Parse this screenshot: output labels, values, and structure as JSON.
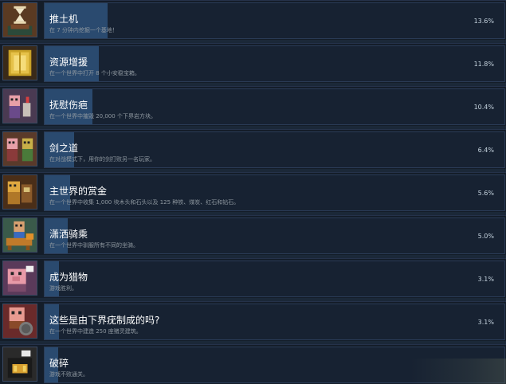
{
  "achievements": [
    {
      "title": "推土机",
      "desc": "在 7 分钟内挖掘一个基地！",
      "percent": "13.6%",
      "progress": 0.136,
      "icon": "hourglass-icon"
    },
    {
      "title": "资源增援",
      "desc": "在一个世界中打开 8 个小安稳宝箱。",
      "percent": "11.8%",
      "progress": 0.118,
      "icon": "gold-block-icon"
    },
    {
      "title": "抚慰伤疤",
      "desc": "在一个世界中摧毁 20,000 个下界岩方块。",
      "percent": "10.4%",
      "progress": 0.104,
      "icon": "character-heal-icon"
    },
    {
      "title": "剑之道",
      "desc": "在对战模式下，用你的剑打败另一名玩家。",
      "percent": "6.4%",
      "progress": 0.064,
      "icon": "swords-duel-icon"
    },
    {
      "title": "主世界的赏金",
      "desc": "在一个世界中收集 1,000 块木头和石头以及 125 种铁、煤炭、红石和钻石。",
      "percent": "5.6%",
      "progress": 0.056,
      "icon": "resource-chest-icon"
    },
    {
      "title": "潇洒骑乘",
      "desc": "在一个世界中驯服所有不同的坐骑。",
      "percent": "5.0%",
      "progress": 0.05,
      "icon": "mount-ride-icon"
    },
    {
      "title": "成为猎物",
      "desc": "游戏胜利。",
      "percent": "3.1%",
      "progress": 0.031,
      "icon": "pig-icon"
    },
    {
      "title": "这些是由下界疣制成的吗?",
      "desc": "在一个世界中建造 250 座猪灵建筑。",
      "percent": "3.1%",
      "progress": 0.031,
      "icon": "piglin-icon"
    },
    {
      "title": "破碎",
      "desc": "游戏不败通关。",
      "percent": "",
      "progress": 0.03,
      "icon": "portal-icon"
    }
  ]
}
